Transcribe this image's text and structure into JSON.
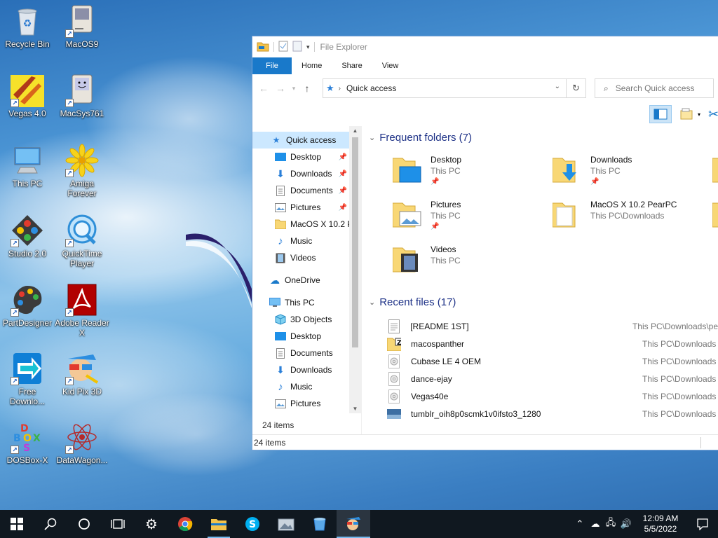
{
  "desktop": {
    "icons": [
      {
        "label": "Recycle Bin",
        "icon": "recycle-bin-icon"
      },
      {
        "label": "MacOS9",
        "icon": "classic-mac-icon"
      },
      {
        "label": "Vegas 4.0",
        "icon": "vegas-icon"
      },
      {
        "label": "MacSys761",
        "icon": "happy-mac-icon"
      },
      {
        "label": "This PC",
        "icon": "computer-icon"
      },
      {
        "label": "Amiga Forever",
        "icon": "daisy-flower-icon"
      },
      {
        "label": "Studio 2.0",
        "icon": "studio-icon"
      },
      {
        "label": "QuickTime Player",
        "icon": "quicktime-icon"
      },
      {
        "label": "PartDesigner",
        "icon": "palette-icon"
      },
      {
        "label": "Adobe Reader X",
        "icon": "adobe-reader-icon"
      },
      {
        "label": "Free Downlo...",
        "icon": "download-arrow-icon"
      },
      {
        "label": "Kid Pix 3D",
        "icon": "kid-pix-icon"
      },
      {
        "label": "DOSBox-X",
        "icon": "dosbox-icon"
      },
      {
        "label": "DataWagon...",
        "icon": "atom-icon"
      }
    ]
  },
  "explorer": {
    "title": "File Explorer",
    "tabs": [
      "File",
      "Home",
      "Share",
      "View"
    ],
    "address": "Quick access",
    "search_placeholder": "Search Quick access",
    "nav": {
      "quick_access": "Quick access",
      "quick_items": [
        {
          "label": "Desktop",
          "pinned": true
        },
        {
          "label": "Downloads",
          "pinned": true
        },
        {
          "label": "Documents",
          "pinned": true
        },
        {
          "label": "Pictures",
          "pinned": true
        },
        {
          "label": "MacOS X 10.2 Pe",
          "pinned": false
        },
        {
          "label": "Music",
          "pinned": false
        },
        {
          "label": "Videos",
          "pinned": false
        }
      ],
      "onedrive": "OneDrive",
      "this_pc": "This PC",
      "pc_items": [
        "3D Objects",
        "Desktop",
        "Documents",
        "Downloads",
        "Music",
        "Pictures"
      ],
      "item_count": "24 items"
    },
    "frequent": {
      "header": "Frequent folders (7)",
      "folders": [
        {
          "name": "Desktop",
          "location": "This PC",
          "pinned": true
        },
        {
          "name": "Downloads",
          "location": "This PC",
          "pinned": true
        },
        {
          "name": "Pictures",
          "location": "This PC",
          "pinned": true
        },
        {
          "name": "MacOS X 10.2 PearPC",
          "location": "This PC\\Downloads",
          "pinned": false
        },
        {
          "name": "Videos",
          "location": "This PC",
          "pinned": false
        }
      ]
    },
    "recent": {
      "header": "Recent files (17)",
      "files": [
        {
          "name": "[README 1ST]",
          "path": "This PC\\Downloads\\pe"
        },
        {
          "name": "macospanther",
          "path": "This PC\\Downloads"
        },
        {
          "name": "Cubase LE 4 OEM",
          "path": "This PC\\Downloads"
        },
        {
          "name": "dance-ejay",
          "path": "This PC\\Downloads"
        },
        {
          "name": "Vegas40e",
          "path": "This PC\\Downloads"
        },
        {
          "name": "tumblr_oih8p0scmk1v0ifsto3_1280",
          "path": "This PC\\Downloads"
        }
      ]
    },
    "status": "24 items"
  },
  "taskbar": {
    "time": "12:09 AM",
    "date": "5/5/2022"
  },
  "colors": {
    "accent": "#1979ca",
    "group_header": "#1e3287",
    "taskbar": "#101820"
  }
}
